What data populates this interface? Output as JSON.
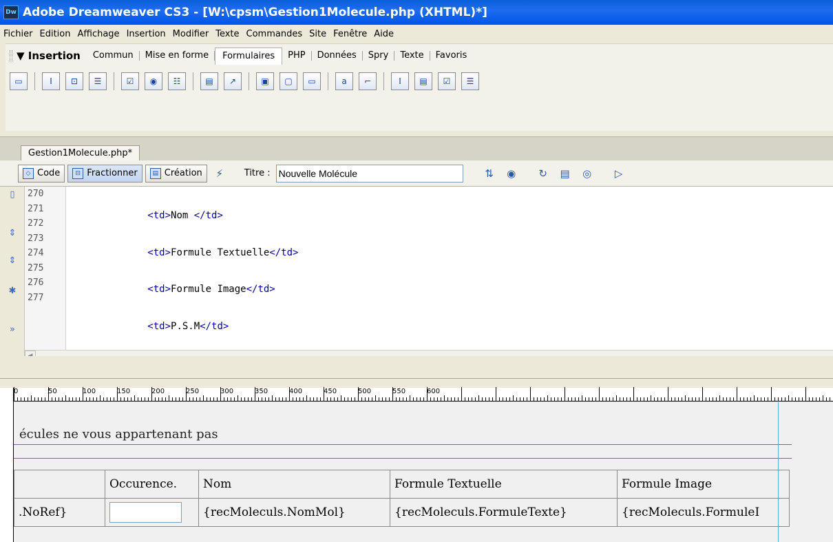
{
  "window": {
    "title": "Adobe Dreamweaver CS3 - [W:\\cpsm\\Gestion1Molecule.php (XHTML)*]",
    "logo": "Dw"
  },
  "menu": [
    "Fichier",
    "Edition",
    "Affichage",
    "Insertion",
    "Modifier",
    "Texte",
    "Commandes",
    "Site",
    "Fenêtre",
    "Aide"
  ],
  "insert_panel": {
    "title": "Insertion",
    "tabs": [
      "Commun",
      "Mise en forme",
      "Formulaires",
      "PHP",
      "Données",
      "Spry",
      "Texte",
      "Favoris"
    ],
    "active_tab": "Formulaires",
    "icons": [
      "form-icon",
      "text-field-icon",
      "hidden-field-icon",
      "textarea-icon",
      "checkbox-icon",
      "radio-button-icon",
      "radio-group-icon",
      "list-menu-icon",
      "jump-menu-icon",
      "image-field-icon",
      "file-field-icon",
      "button-icon",
      "label-icon",
      "fieldset-icon",
      "spry-text-field-icon",
      "spry-select-icon",
      "spry-checkbox-icon",
      "spry-textarea-icon"
    ]
  },
  "document": {
    "tab": "Gestion1Molecule.php*",
    "views": {
      "code": "Code",
      "split": "Fractionner",
      "design": "Création"
    },
    "title_label": "Titre :",
    "title_value": "Nouvelle Molécule"
  },
  "code": {
    "line_numbers": [
      "270",
      "271",
      "272",
      "273",
      "274",
      "275",
      "276",
      "277"
    ]
  },
  "ruler": {
    "labels": [
      "0",
      "50",
      "100",
      "150",
      "200",
      "250",
      "300",
      "350",
      "400",
      "450",
      "500",
      "550",
      "600"
    ]
  },
  "design": {
    "partial_text": "écules ne vous appartenant pas",
    "header_cells": [
      "",
      "Occurence.",
      "Nom",
      "Formule Textuelle",
      "Formule Image"
    ],
    "row_cells": [
      ".NoRef}",
      "",
      "{recMoleculs.NomMol}",
      "{recMoleculs.FormuleTexte}",
      "{recMoleculs.FormuleI"
    ]
  }
}
